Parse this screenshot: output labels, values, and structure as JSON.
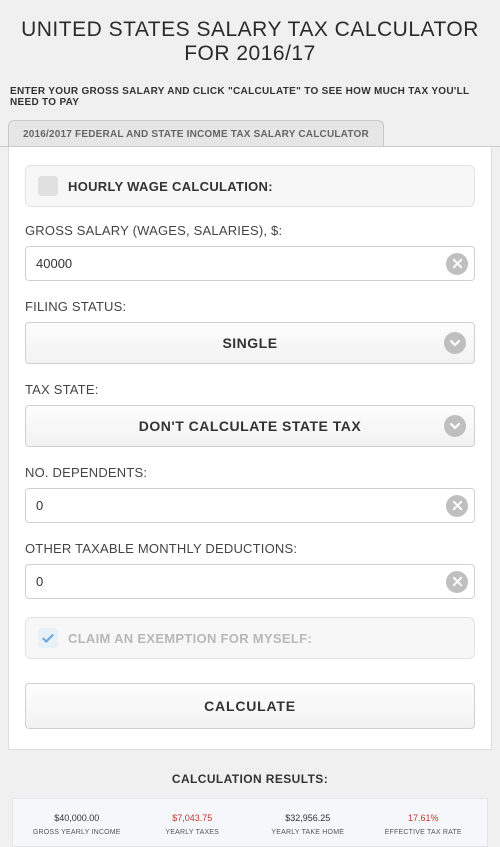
{
  "title": "UNITED STATES SALARY TAX CALCULATOR FOR 2016/17",
  "instruction": "ENTER YOUR GROSS SALARY AND CLICK \"CALCULATE\" TO SEE HOW MUCH TAX YOU'LL NEED TO PAY",
  "tab": "2016/2017 FEDERAL AND STATE INCOME TAX SALARY CALCULATOR",
  "hourly": {
    "label": "HOURLY WAGE CALCULATION:"
  },
  "gross": {
    "label": "GROSS SALARY (WAGES, SALARIES), $:",
    "value": "40000"
  },
  "filing": {
    "label": "FILING STATUS:",
    "value": "SINGLE"
  },
  "state": {
    "label": "TAX STATE:",
    "value": "DON'T CALCULATE STATE TAX"
  },
  "dependents": {
    "label": "NO. DEPENDENTS:",
    "value": "0"
  },
  "deductions": {
    "label": "OTHER TAXABLE MONTHLY DEDUCTIONS:",
    "value": "0"
  },
  "exemption": {
    "label": "CLAIM AN EXEMPTION FOR MYSELF:"
  },
  "calculate": "CALCULATE",
  "results": {
    "title": "CALCULATION RESULTS:",
    "cells": [
      {
        "value": "$40,000.00",
        "label": "GROSS YEARLY INCOME"
      },
      {
        "value": "$7,043.75",
        "label": "YEARLY TAXES"
      },
      {
        "value": "$32,956.25",
        "label": "YEARLY TAKE HOME"
      },
      {
        "value": "17.61%",
        "label": "EFFECTIVE TAX RATE"
      }
    ]
  }
}
